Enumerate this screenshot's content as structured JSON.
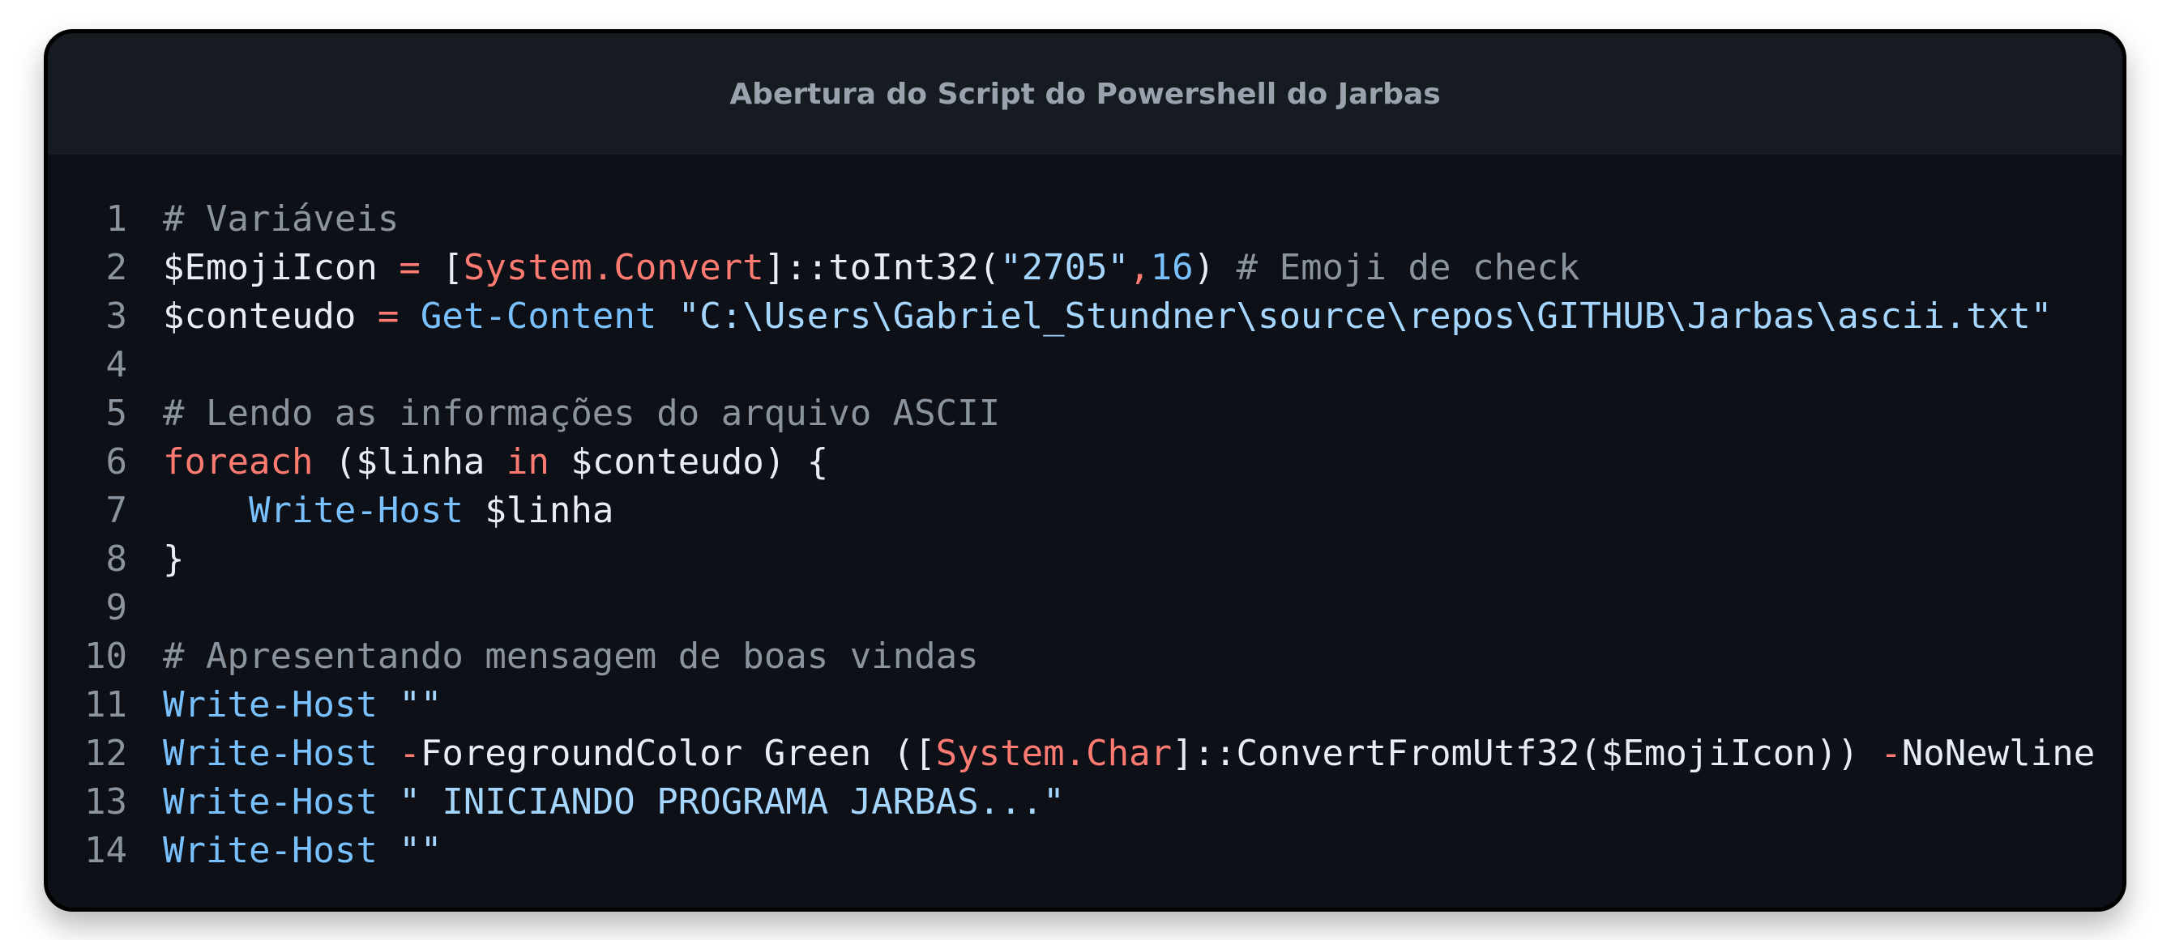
{
  "window": {
    "title": "Abertura do Script do Powershell do Jarbas"
  },
  "code": {
    "line_numbers": [
      "1",
      "2",
      "3",
      "4",
      "5",
      "6",
      "7",
      "8",
      "9",
      "10",
      "11",
      "12",
      "13",
      "14"
    ],
    "lines": [
      [
        {
          "cls": "c",
          "text": "# Variáveis"
        }
      ],
      [
        {
          "cls": "v",
          "text": "$EmojiIcon "
        },
        {
          "cls": "o",
          "text": "="
        },
        {
          "cls": "v",
          "text": " ["
        },
        {
          "cls": "t",
          "text": "System.Convert"
        },
        {
          "cls": "v",
          "text": "]::toInt32("
        },
        {
          "cls": "s",
          "text": "\"2705\""
        },
        {
          "cls": "o",
          "text": ","
        },
        {
          "cls": "n",
          "text": "16"
        },
        {
          "cls": "v",
          "text": ") "
        },
        {
          "cls": "c",
          "text": "# Emoji de check"
        }
      ],
      [
        {
          "cls": "v",
          "text": "$conteudo "
        },
        {
          "cls": "o",
          "text": "="
        },
        {
          "cls": "v",
          "text": " "
        },
        {
          "cls": "f",
          "text": "Get-Content"
        },
        {
          "cls": "v",
          "text": " "
        },
        {
          "cls": "s",
          "text": "\"C:\\Users\\Gabriel_Stundner\\source\\repos\\GITHUB\\Jarbas\\ascii.txt\""
        }
      ],
      [],
      [
        {
          "cls": "c",
          "text": "# Lendo as informações do arquivo ASCII"
        }
      ],
      [
        {
          "cls": "k",
          "text": "foreach"
        },
        {
          "cls": "v",
          "text": " ($linha "
        },
        {
          "cls": "k",
          "text": "in"
        },
        {
          "cls": "v",
          "text": " $conteudo) {"
        }
      ],
      [
        {
          "cls": "v",
          "text": "    "
        },
        {
          "cls": "f",
          "text": "Write-Host"
        },
        {
          "cls": "v",
          "text": " $linha"
        }
      ],
      [
        {
          "cls": "v",
          "text": "}"
        }
      ],
      [],
      [
        {
          "cls": "c",
          "text": "# Apresentando mensagem de boas vindas"
        }
      ],
      [
        {
          "cls": "f",
          "text": "Write-Host"
        },
        {
          "cls": "v",
          "text": " "
        },
        {
          "cls": "s",
          "text": "\"\""
        }
      ],
      [
        {
          "cls": "f",
          "text": "Write-Host"
        },
        {
          "cls": "v",
          "text": " "
        },
        {
          "cls": "o",
          "text": "-"
        },
        {
          "cls": "v",
          "text": "ForegroundColor Green (["
        },
        {
          "cls": "t",
          "text": "System.Char"
        },
        {
          "cls": "v",
          "text": "]::ConvertFromUtf32($EmojiIcon)) "
        },
        {
          "cls": "o",
          "text": "-"
        },
        {
          "cls": "v",
          "text": "NoNewline"
        }
      ],
      [
        {
          "cls": "f",
          "text": "Write-Host"
        },
        {
          "cls": "v",
          "text": " "
        },
        {
          "cls": "s",
          "text": "\" INICIANDO PROGRAMA JARBAS...\""
        }
      ],
      [
        {
          "cls": "f",
          "text": "Write-Host"
        },
        {
          "cls": "v",
          "text": " "
        },
        {
          "cls": "s",
          "text": "\"\""
        }
      ]
    ]
  },
  "colors": {
    "background": "#0d1117",
    "titlebar": "#161b22",
    "comment": "#8b949e",
    "text": "#e6edf3",
    "keyword": "#ff7b72",
    "function": "#79c0ff",
    "string": "#a5d6ff"
  }
}
